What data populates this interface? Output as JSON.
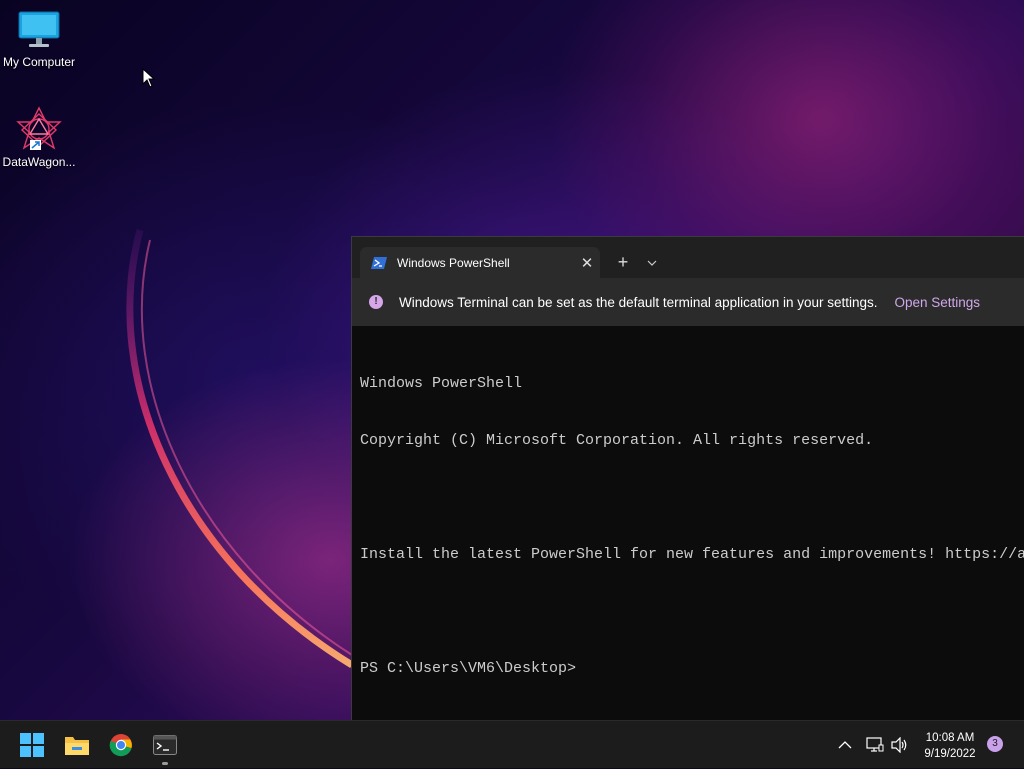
{
  "desktop": {
    "icons": [
      {
        "label": "My Computer",
        "icon": "monitor-icon"
      },
      {
        "label": "DataWagon...",
        "icon": "datawagon-app-icon"
      }
    ]
  },
  "terminal": {
    "tab_title": "Windows PowerShell",
    "tab_icon": "powershell-icon",
    "close_glyph": "✕",
    "new_tab_glyph": "+",
    "dropdown_glyph": "⌄",
    "info_icon_glyph": "!",
    "infobar": {
      "message": "Windows Terminal can be set as the default terminal application in your settings.",
      "link": "Open Settings"
    },
    "console_lines": [
      "Windows PowerShell",
      "Copyright (C) Microsoft Corporation. All rights reserved.",
      "",
      "Install the latest PowerShell for new features and improvements! https://a",
      "",
      "PS C:\\Users\\VM6\\Desktop>"
    ]
  },
  "taskbar": {
    "apps": [
      "windows-start-icon",
      "file-explorer-icon",
      "chrome-icon",
      "terminal-icon"
    ],
    "tray": {
      "chevron": "^",
      "time": "10:08 AM",
      "date": "9/19/2022",
      "notifications": "3"
    }
  },
  "colors": {
    "terminal_bg": "#0c0c0c",
    "tab_bg": "#2b2b2b",
    "accent_link": "#cfa8ea",
    "taskbar_bg": "#1c1c1c"
  }
}
